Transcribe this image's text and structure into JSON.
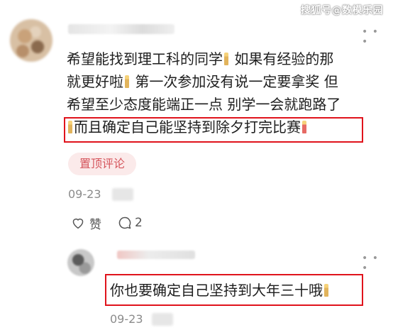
{
  "watermark": "搜狐号@数模乐园",
  "comment": {
    "line1": "希望能找到理工科的同学",
    "line1b": " 如果有经验的那",
    "line2a": "就更好啦",
    "line2b": " 第一次参加没有说一定要拿奖 但",
    "line3": "希望至少态度能端正一点 别学一会就跑路了",
    "line4": "而且确定自己能坚持到除夕打完比赛",
    "pin_label": "置顶评论",
    "date": "09-23",
    "like_label": "赞",
    "reply_count": "2"
  },
  "reply": {
    "text": "你也要确定自己坚持到大年三十哦",
    "date": "09-23"
  },
  "icons": {
    "candle": "candle-emoji-icon",
    "heart": "heart-icon",
    "comment": "comment-bubble-icon",
    "more": "more-dots-icon"
  },
  "colors": {
    "highlight_border": "#e0131c",
    "pin_bg": "#fbeaea",
    "pin_text": "#d5555c",
    "meta_text": "#8c8c8c"
  }
}
